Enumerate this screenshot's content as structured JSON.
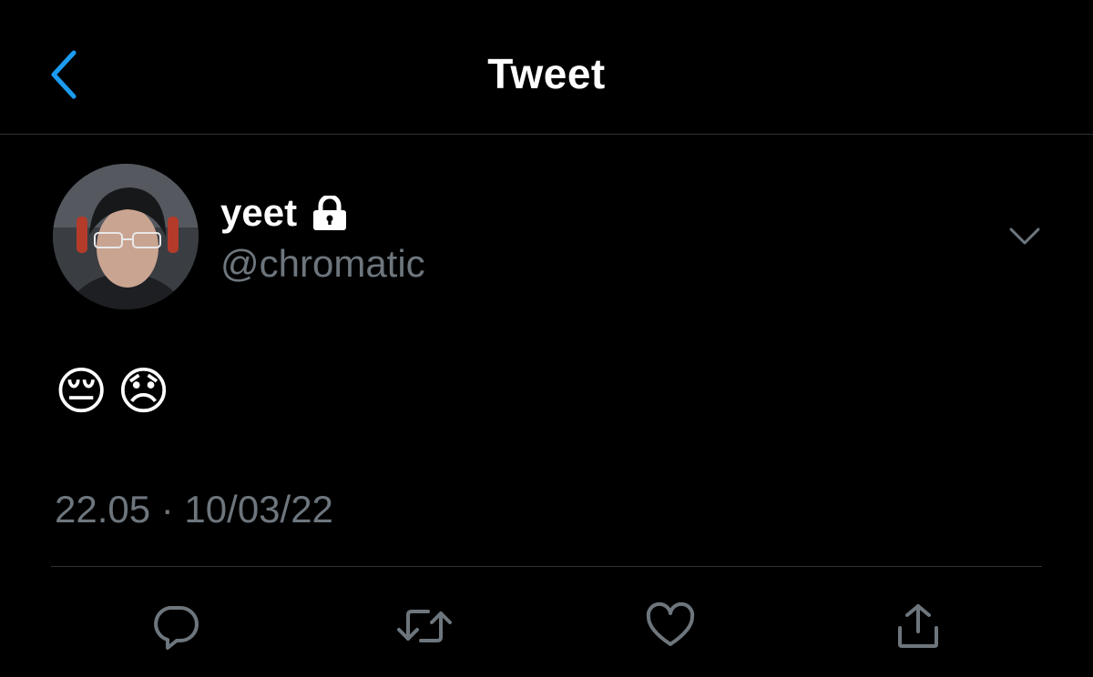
{
  "header": {
    "title": "Tweet",
    "back_icon": "chevron-left-icon"
  },
  "tweet": {
    "author": {
      "display_name": "yeet",
      "handle": "@chromatic",
      "protected_icon": "lock-icon",
      "avatar": "avatar-photo"
    },
    "text": "😔😞",
    "timestamp": "22.05 · 10/03/22",
    "more_icon": "chevron-down-icon"
  },
  "actions": [
    {
      "name": "reply",
      "icon": "reply-icon"
    },
    {
      "name": "retweet",
      "icon": "retweet-icon"
    },
    {
      "name": "like",
      "icon": "heart-icon"
    },
    {
      "name": "share",
      "icon": "share-icon"
    }
  ],
  "colors": {
    "accent": "#1d9bf0",
    "secondary_text": "#6e767d",
    "divider": "#2f3336",
    "background": "#000000"
  }
}
